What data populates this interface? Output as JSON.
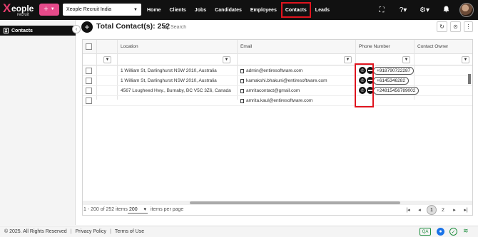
{
  "brand": {
    "name": "Xeople",
    "x_letter": "X",
    "main": "eople",
    "sub": "recruit"
  },
  "add_button": {
    "icon": "plus-icon",
    "label": "+"
  },
  "company_select": {
    "value": "Xeople Recruit India"
  },
  "nav": {
    "items": [
      {
        "label": "Home"
      },
      {
        "label": "Clients"
      },
      {
        "label": "Jobs"
      },
      {
        "label": "Candidates"
      },
      {
        "label": "Employees"
      },
      {
        "label": "Contacts",
        "active": true
      },
      {
        "label": "Leads"
      }
    ]
  },
  "top_icons": [
    "fullscreen-icon",
    "help-icon",
    "settings-icon",
    "bell-icon",
    "avatar"
  ],
  "sidebar": {
    "items": [
      {
        "label": "Contacts",
        "icon": "contacts-icon"
      }
    ]
  },
  "header": {
    "total_label": "Total Contact(s): 252",
    "search_placeholder": "Search"
  },
  "grid": {
    "columns": [
      "",
      "",
      "Location",
      "Email",
      "Phone Number",
      "Contact Owner"
    ],
    "rows": [
      {
        "location": "1 William St, Darlinghurst NSW 2010, Australia",
        "email": "admin@entiresoftware.com",
        "phone": "+918790722287"
      },
      {
        "location": "1 William St, Darlinghurst NSW 2010, Australia",
        "email": "kamakshi.bhakuni@entiresoftware.com",
        "phone": "+6145346282"
      },
      {
        "location": "4567 Lougheed Hwy., Burnaby, BC V5C 3Z6, Canada",
        "email": "amritacontact@gmail.com",
        "phone": "+24815456789002"
      },
      {
        "location": "",
        "email": "amrita.kaul@entiresoftware.com",
        "phone": ""
      }
    ]
  },
  "pager": {
    "info": "1 - 200 of 252 items",
    "page_size": "200",
    "page_size_label": "items per page",
    "pages": [
      "1",
      "2"
    ],
    "current_page": "1"
  },
  "footer": {
    "copyright": "© 2025. All Rights Reserved",
    "privacy": "Privacy Policy",
    "terms": "Terms of Use",
    "qa": "QA"
  },
  "colors": {
    "accent_pink": "#e64a8a",
    "highlight_red": "#e0141e",
    "topbar": "#111111"
  }
}
